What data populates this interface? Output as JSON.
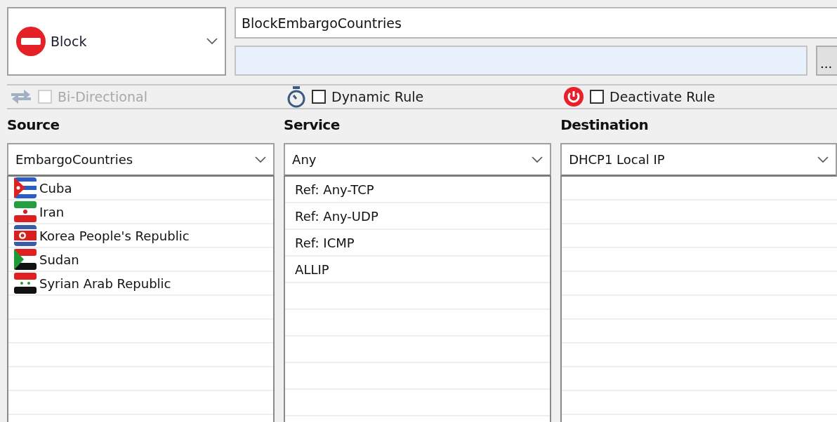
{
  "action": {
    "label": "Block"
  },
  "rule_name": {
    "value": "BlockEmbargoCountries"
  },
  "comment": {
    "browse_label": "..."
  },
  "options": [
    {
      "kind": "bidirectional",
      "label": "Bi-Directional",
      "checked": false,
      "disabled": true
    },
    {
      "kind": "dynamic",
      "label": "Dynamic Rule",
      "checked": false,
      "disabled": false
    },
    {
      "kind": "deactivate",
      "label": "Deactivate Rule",
      "checked": false,
      "disabled": false
    }
  ],
  "columns": [
    {
      "kind": "source",
      "heading": "Source",
      "selection": "EmbargoCountries",
      "items": [
        {
          "label": "Cuba"
        },
        {
          "label": "Iran"
        },
        {
          "label": "Korea People's Republic"
        },
        {
          "label": "Sudan"
        },
        {
          "label": "Syrian Arab Republic"
        }
      ]
    },
    {
      "kind": "service",
      "heading": "Service",
      "selection": "Any",
      "items": [
        {
          "label": "Ref: Any-TCP"
        },
        {
          "label": "Ref: Any-UDP"
        },
        {
          "label": "Ref: ICMP"
        },
        {
          "label": "ALLIP"
        }
      ]
    },
    {
      "kind": "destination",
      "heading": "Destination",
      "selection": "DHCP1 Local IP"
    }
  ]
}
